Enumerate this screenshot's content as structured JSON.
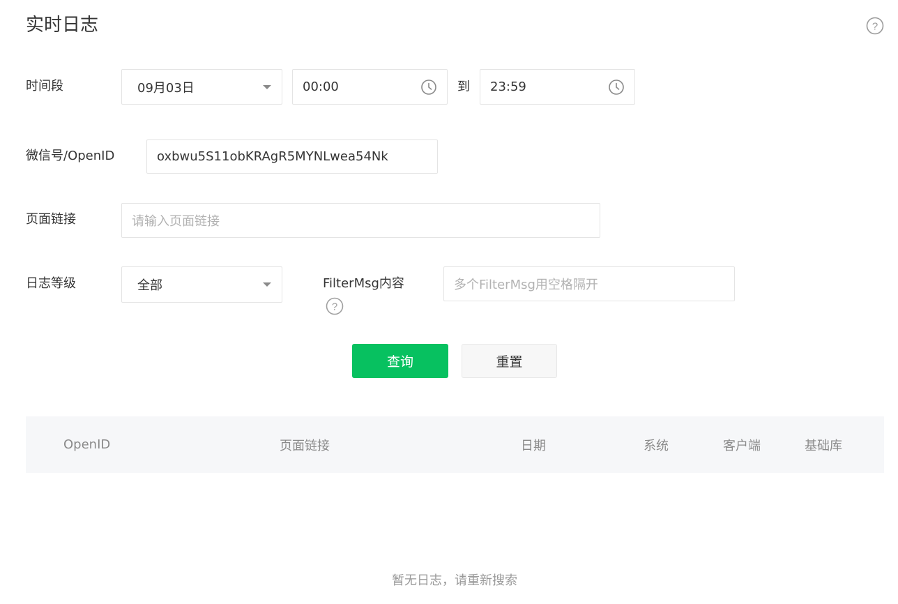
{
  "header": {
    "title": "实时日志",
    "help_icon": "help-circle-icon"
  },
  "form": {
    "time_range": {
      "label": "时间段",
      "date_value": "09月03日",
      "start_time": "00:00",
      "to_label": "到",
      "end_time": "23:59"
    },
    "openid": {
      "label": "微信号/OpenID",
      "value": "oxbwu5S11obKRAgR5MYNLwea54Nk"
    },
    "page_link": {
      "label": "页面链接",
      "placeholder": "请输入页面链接"
    },
    "log_level": {
      "label": "日志等级",
      "value": "全部"
    },
    "filter_msg": {
      "label": "FilterMsg内容",
      "placeholder": "多个FilterMsg用空格隔开"
    },
    "buttons": {
      "search_label": "查询",
      "reset_label": "重置"
    }
  },
  "table": {
    "columns": [
      "OpenID",
      "页面链接",
      "日期",
      "系统",
      "客户端",
      "基础库"
    ],
    "empty_text": "暂无日志，请重新搜索"
  },
  "colors": {
    "primary": "#07c160",
    "table_header_bg": "#f6f7f9",
    "placeholder": "#b2b2b2"
  }
}
